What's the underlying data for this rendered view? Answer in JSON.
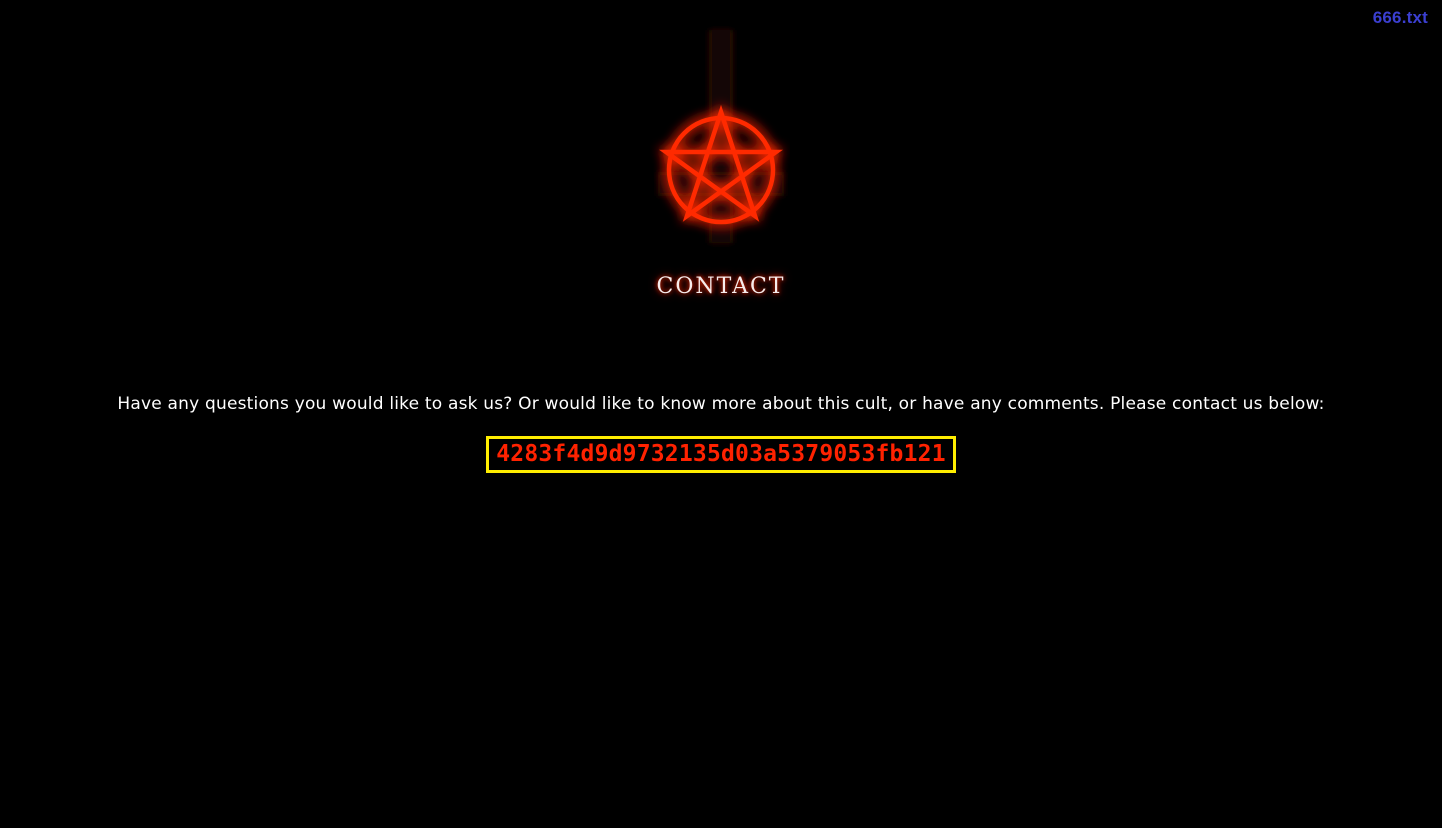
{
  "header": {
    "link_label": "666.txt"
  },
  "page": {
    "heading": "CONTACT",
    "intro_text": "Have any questions you would like to ask us? Or would like to know more about this cult, or have any comments. Please contact us below:",
    "contact_token": "4283f4d9d9732135d03a5379053fb121"
  },
  "emblem": {
    "icon": "inverted-cross-pentagram-icon",
    "glow_color": "#ff2a00",
    "cross_color": "#120606"
  },
  "colors": {
    "background": "#000000",
    "link": "#3b3fd0",
    "token_text": "#ff2200",
    "token_border": "#ffee00"
  }
}
